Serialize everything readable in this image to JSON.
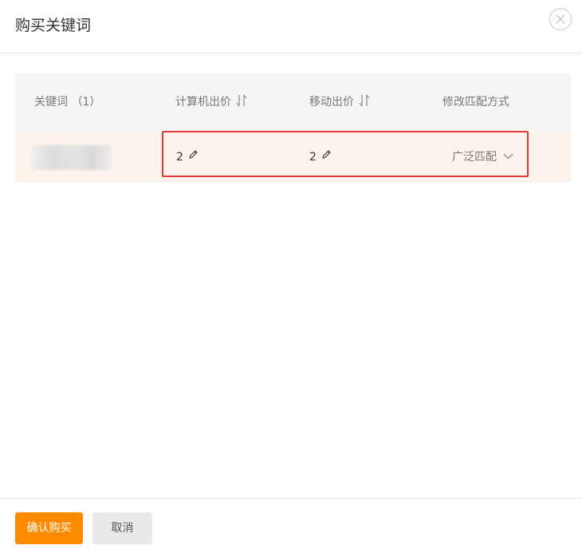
{
  "dialog": {
    "title": "购买关键词"
  },
  "table": {
    "headers": {
      "keyword": "关键词 （1）",
      "pc_bid": "计算机出价",
      "mobile_bid": "移动出价",
      "match_type": "修改匹配方式"
    },
    "rows": [
      {
        "keyword": "",
        "pc_bid": "2",
        "mobile_bid": "2",
        "match_type": "广泛匹配"
      }
    ]
  },
  "footer": {
    "confirm_label": "确认购买",
    "cancel_label": "取消"
  },
  "colors": {
    "accent": "#ff8a00",
    "highlight": "#e23b3b",
    "row_bg": "#fcf3ec"
  },
  "icons": [
    "close-icon",
    "sort-icon",
    "pencil-icon",
    "chevron-down-icon"
  ]
}
